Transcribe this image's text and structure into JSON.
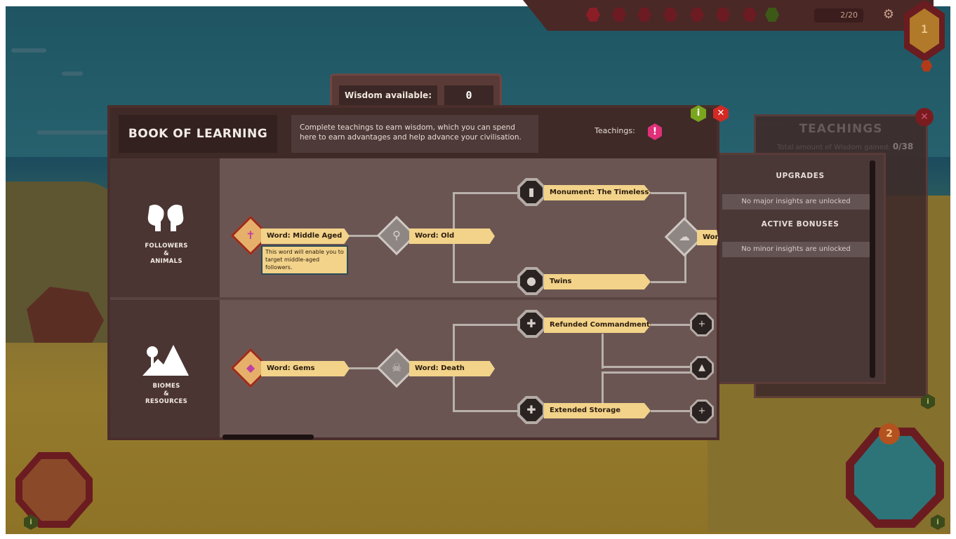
{
  "hud": {
    "population": "2/20",
    "settings_icon": "gear-icon",
    "level_badge": "1",
    "minimap_badge": "2"
  },
  "teachings_panel": {
    "title": "TEACHINGS",
    "subtitle": "Total amount of Wisdom gained:",
    "count": "0/38",
    "icon_close": "close-icon"
  },
  "upgrades": {
    "upgrades_heading": "UPGRADES",
    "upgrades_empty": "No major insights are unlocked",
    "bonuses_heading": "ACTIVE BONUSES",
    "bonuses_empty": "No minor insights are unlocked"
  },
  "wisdom": {
    "label": "Wisdom available:",
    "value": "0"
  },
  "book": {
    "title": "BOOK OF LEARNING",
    "description": "Complete teachings to earn wisdom, which you can spend here to earn advantages and help advance your civilisation.",
    "teachings_label": "Teachings:",
    "alert_glyph": "!",
    "info_glyph": "i",
    "close_glyph": "✕"
  },
  "categories": {
    "followers": {
      "line1": "FOLLOWERS",
      "line2": "&",
      "line3": "ANIMALS",
      "nodes": {
        "middle_aged": "Word: Middle Aged",
        "old": "Word: Old",
        "monument": "Monument: The Timeless",
        "twins": "Twins",
        "cut": "Wor"
      },
      "tooltip": "This word will enable you to target middle-aged followers."
    },
    "biomes": {
      "line1": "BIOMES",
      "line2": "&",
      "line3": "RESOURCES",
      "nodes": {
        "gems": "Word: Gems",
        "death": "Word: Death",
        "refunded": "Refunded Commandment",
        "storage": "Extended Storage"
      }
    }
  },
  "colors": {
    "panel": "#5a4341",
    "ribbon": "#f2d389",
    "accent_pink": "#e0307a",
    "info_green": "#7aa51f",
    "close_red": "#d22a25"
  }
}
